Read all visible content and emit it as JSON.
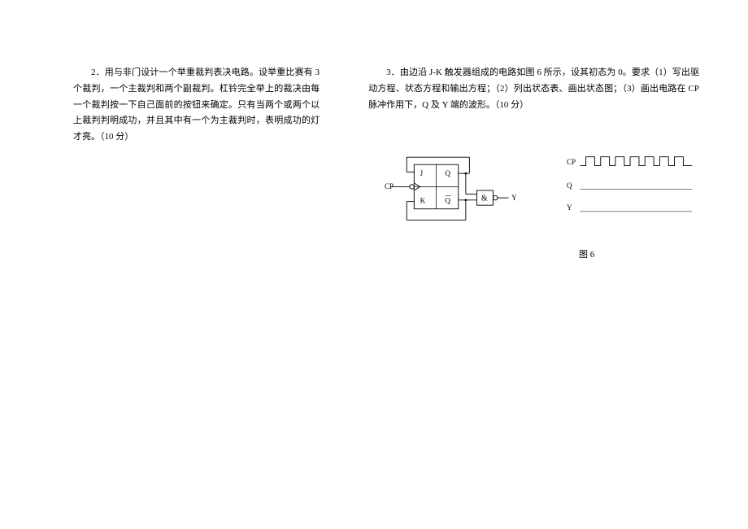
{
  "left": {
    "q2_text": "2．用与非门设计一个举重裁判表决电路。设举重比赛有 3 个裁判，一个主裁判和两个副裁判。杠铃完全举上的裁决由每一个裁判按一下自己面前的按钮来确定。只有当两个或两个以上裁判判明成功，并且其中有一个为主裁判时，表明成功的灯才亮。（10 分）"
  },
  "right": {
    "q3_text": "3．由边沿 J-K 触发器组成的电路如图 6 所示，设其初态为 0。要求（1）写出驱动方程、状态方程和输出方程；（2）列出状态表、画出状态图；（3）画出电路在 CP 脉冲作用下，Q 及 Y 端的波形。（10 分）",
    "circuit": {
      "cp_label": "CP",
      "j_label": "J",
      "k_label": "K",
      "q_label": "Q",
      "qbar_label": "Q̄",
      "gate_label": "&",
      "y_label": "Y"
    },
    "waveform": {
      "cp_label": "CP",
      "q_label": "Q",
      "y_label": "Y"
    },
    "fig_caption": "图 6"
  }
}
